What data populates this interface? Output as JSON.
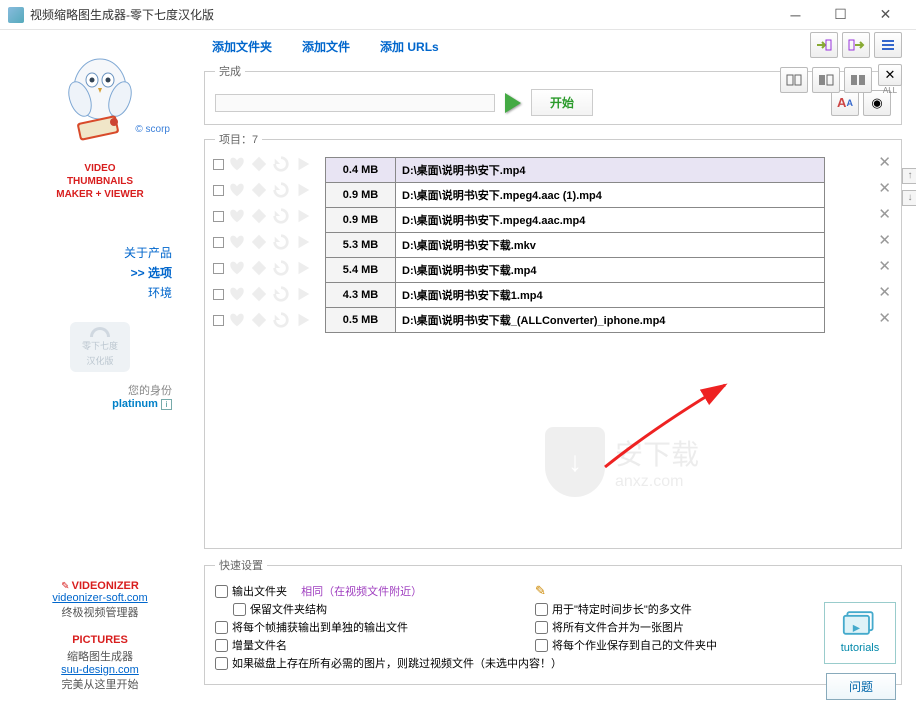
{
  "window": {
    "title": "视频缩略图生成器-零下七度汉化版"
  },
  "app": {
    "name_l1": "VIDEO",
    "name_l2": "THUMBNAILS",
    "name_l3": "MAKER + VIEWER",
    "scorp": "© scorp"
  },
  "menu": {
    "about": "关于产品",
    "options": ">> 选项",
    "env": "环境"
  },
  "graycard": {
    "l1": "零下七度",
    "l2": "汉化版"
  },
  "identity": {
    "label": "您的身份",
    "value": "platinum"
  },
  "bottom": {
    "videonizer": "VIDEONIZER",
    "vid_url": "videonizer-soft.com",
    "vid_sub": "终极视频管理器",
    "pictures": "PICTURES",
    "pic_sub1": "缩略图生成器",
    "pic_url": "suu-design.com",
    "pic_sub2": "完美从这里开始"
  },
  "top": {
    "add_folder": "添加文件夹",
    "add_file": "添加文件",
    "add_urls": "添加 URLs"
  },
  "progress": {
    "legend": "完成",
    "start": "开始"
  },
  "items": {
    "legend": "项目：7",
    "rows": [
      {
        "size": "0.4 MB",
        "path": "D:\\桌面\\说明书\\安下.mp4"
      },
      {
        "size": "0.9 MB",
        "path": "D:\\桌面\\说明书\\安下.mpeg4.aac (1).mp4"
      },
      {
        "size": "0.9 MB",
        "path": "D:\\桌面\\说明书\\安下.mpeg4.aac.mp4"
      },
      {
        "size": "5.3 MB",
        "path": "D:\\桌面\\说明书\\安下载.mkv"
      },
      {
        "size": "5.4 MB",
        "path": "D:\\桌面\\说明书\\安下载.mp4"
      },
      {
        "size": "4.3 MB",
        "path": "D:\\桌面\\说明书\\安下载1.mp4"
      },
      {
        "size": "0.5 MB",
        "path": "D:\\桌面\\说明书\\安下载_(ALLConverter)_iphone.mp4"
      }
    ]
  },
  "watermark": {
    "text": "安下载",
    "url": "anxz.com"
  },
  "quick": {
    "legend": "快速设置",
    "out_folder": "输出文件夹",
    "same": "相同（在视频文件附近）",
    "keep_struct": "保留文件夹结构",
    "timestep": "用于\"特定时间步长\"的多文件",
    "each_frame": "将每个帧捕获输出到单独的输出文件",
    "merge_all": "将所有文件合并为一张图片",
    "inc_name": "增量文件名",
    "save_each": "将每个作业保存到自己的文件夹中",
    "skip_if": "如果磁盘上存在所有必需的图片，则跳过视频文件（未选中内容！）"
  },
  "tutorials": {
    "label": "tutorials"
  },
  "question": "问题",
  "toolbar": {
    "all": "ALL"
  }
}
